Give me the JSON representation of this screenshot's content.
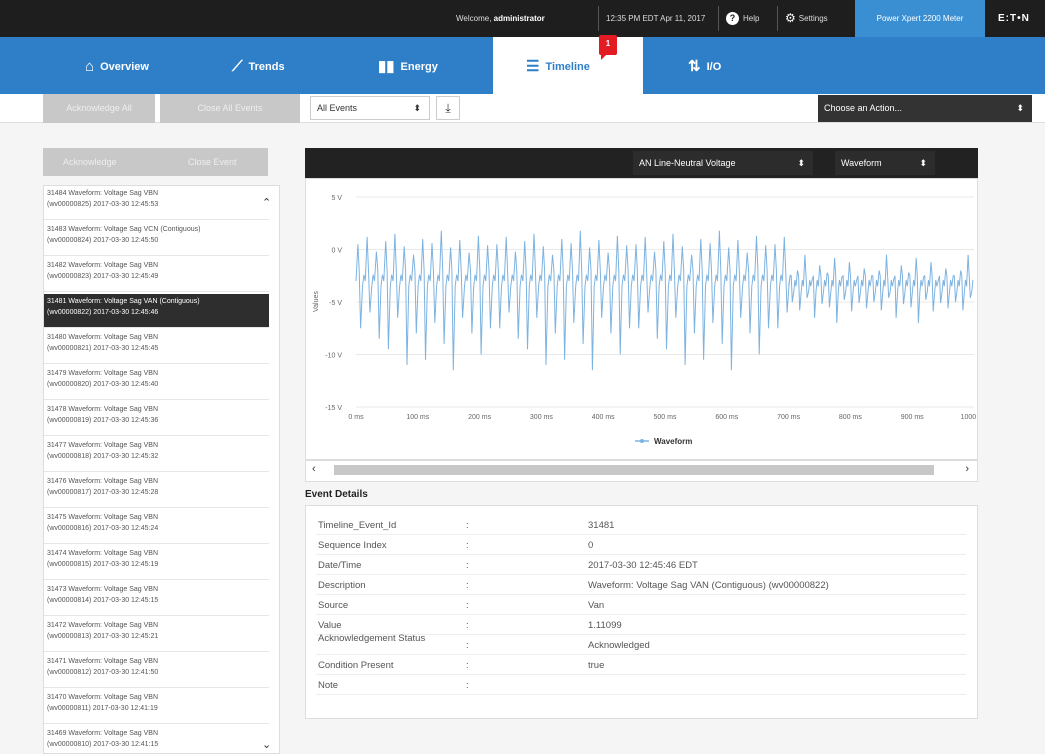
{
  "topbar": {
    "welcome_prefix": "Welcome,",
    "user": "administrator",
    "datetime": "12:35 PM EDT Apr 11, 2017",
    "help": "Help",
    "settings": "Settings",
    "meter": "Power Xpert 2200 Meter",
    "logo": "E:T•N"
  },
  "nav": {
    "tabs": [
      {
        "label": "Overview",
        "icon": "home-icon"
      },
      {
        "label": "Trends",
        "icon": "trend-line-icon"
      },
      {
        "label": "Energy",
        "icon": "bar-chart-icon"
      },
      {
        "label": "Timeline",
        "icon": "list-icon",
        "badge": "1"
      },
      {
        "label": "I/O",
        "icon": "io-arrows-icon"
      }
    ],
    "active_tab": "Timeline"
  },
  "toolbar": {
    "acknowledge_all": "Acknowledge All",
    "close_all": "Close All Events",
    "filter_value": "All Events",
    "action_value": "Choose an Action..."
  },
  "left_panel": {
    "acknowledge": "Acknowledge",
    "close_event": "Close Event",
    "events": [
      {
        "line1": "31484 Waveform: Voltage Sag VBN",
        "line2": "(wv00000825) 2017-03-30 12:45:53",
        "selected": false
      },
      {
        "line1": "31483 Waveform: Voltage Sag VCN (Contiguous)",
        "line2": "(wv00000824) 2017-03-30 12:45:50",
        "selected": false
      },
      {
        "line1": "31482 Waveform: Voltage Sag VBN",
        "line2": "(wv00000823) 2017-03-30 12:45:49",
        "selected": false
      },
      {
        "line1": "31481 Waveform: Voltage Sag VAN (Contiguous)",
        "line2": "(wv00000822) 2017-03-30 12:45:46",
        "selected": true
      },
      {
        "line1": "31480 Waveform: Voltage Sag VBN",
        "line2": "(wv00000821) 2017-03-30 12:45:45",
        "selected": false
      },
      {
        "line1": "31479 Waveform: Voltage Sag VBN",
        "line2": "(wv00000820) 2017-03-30 12:45:40",
        "selected": false
      },
      {
        "line1": "31478 Waveform: Voltage Sag VBN",
        "line2": "(wv00000819) 2017-03-30 12:45:36",
        "selected": false
      },
      {
        "line1": "31477 Waveform: Voltage Sag VBN",
        "line2": "(wv00000818) 2017-03-30 12:45:32",
        "selected": false
      },
      {
        "line1": "31476 Waveform: Voltage Sag VBN",
        "line2": "(wv00000817) 2017-03-30 12:45:28",
        "selected": false
      },
      {
        "line1": "31475 Waveform: Voltage Sag VBN",
        "line2": "(wv00000816) 2017-03-30 12:45:24",
        "selected": false
      },
      {
        "line1": "31474 Waveform: Voltage Sag VBN",
        "line2": "(wv00000815) 2017-03-30 12:45:19",
        "selected": false
      },
      {
        "line1": "31473 Waveform: Voltage Sag VBN",
        "line2": "(wv00000814) 2017-03-30 12:45:15",
        "selected": false
      },
      {
        "line1": "31472 Waveform: Voltage Sag VBN",
        "line2": "(wv00000813) 2017-03-30 12:45:21",
        "selected": false
      },
      {
        "line1": "31471 Waveform: Voltage Sag VBN",
        "line2": "(wv00000812) 2017-03-30 12:41:50",
        "selected": false
      },
      {
        "line1": "31470 Waveform: Voltage Sag VBN",
        "line2": "(wv00000811) 2017-03-30 12:41:19",
        "selected": false
      },
      {
        "line1": "31469 Waveform: Voltage Sag VBN",
        "line2": "(wv00000810) 2017-03-30 12:41:15",
        "selected": false
      }
    ]
  },
  "chart_header": {
    "channel": "AN Line-Neutral Voltage",
    "view": "Waveform"
  },
  "chart_data": {
    "type": "line",
    "title": "",
    "xlabel": "",
    "ylabel": "Values",
    "x_ticks": [
      "0 ms",
      "100 ms",
      "200 ms",
      "300 ms",
      "400 ms",
      "500 ms",
      "600 ms",
      "700 ms",
      "800 ms",
      "900 ms",
      "1000 ms"
    ],
    "y_ticks": [
      "5 V",
      "0 V",
      "-5 V",
      "-10 V",
      "-15 V"
    ],
    "xlim": [
      0,
      1000
    ],
    "ylim": [
      -15,
      5
    ],
    "grid": true,
    "legend": "bottom-center",
    "color": "#7eb3e0",
    "series": [
      {
        "name": "Waveform",
        "segments": [
          {
            "x_start": 0,
            "x_end": 700,
            "spike_period": 15,
            "baseline": -3.0,
            "high": [
              0.5,
              1.2,
              -0.2,
              0.8,
              1.5,
              0.3,
              -0.5,
              1.0,
              0.6,
              1.8,
              0.2,
              0.9,
              -0.3,
              1.3,
              0.4
            ],
            "low": [
              -7.5,
              -6.0,
              -8.5,
              -9.5,
              -6.5,
              -11.0,
              -8.0,
              -10.5,
              -7.0,
              -9.0,
              -11.5,
              -6.5,
              -8.0,
              -10.0,
              -7.5
            ]
          },
          {
            "x_start": 700,
            "x_end": 1000,
            "spike_period": 12,
            "baseline": -3.5,
            "high": [
              -2.5,
              -2.0,
              -0.5,
              -2.8,
              -1.5,
              -2.2,
              -0.8,
              -2.6,
              -1.2,
              -2.9,
              -1.8
            ],
            "low": [
              -5.0,
              -5.8,
              -4.6,
              -6.5,
              -5.2,
              -5.5,
              -7.0,
              -4.8,
              -5.9,
              -5.1,
              -5.6
            ]
          }
        ]
      }
    ]
  },
  "scrollbar": {
    "left": "‹",
    "right": "›"
  },
  "event_details": {
    "title": "Event Details",
    "separator": ":",
    "rows": [
      {
        "label": "Timeline_Event_Id",
        "value": "31481"
      },
      {
        "label": "Sequence Index",
        "value": "0"
      },
      {
        "label": "Date/Time",
        "value": "2017-03-30 12:45:46 EDT"
      },
      {
        "label": "Description",
        "value": "Waveform: Voltage Sag VAN (Contiguous) (wv00000822)"
      },
      {
        "label": "Source",
        "value": "Van"
      },
      {
        "label": "Value",
        "value": "1.11099"
      },
      {
        "label": "Acknowledgement Status",
        "value": "Acknowledged"
      },
      {
        "label": "Condition Present",
        "value": "true"
      },
      {
        "label": "Note",
        "value": ""
      }
    ]
  }
}
